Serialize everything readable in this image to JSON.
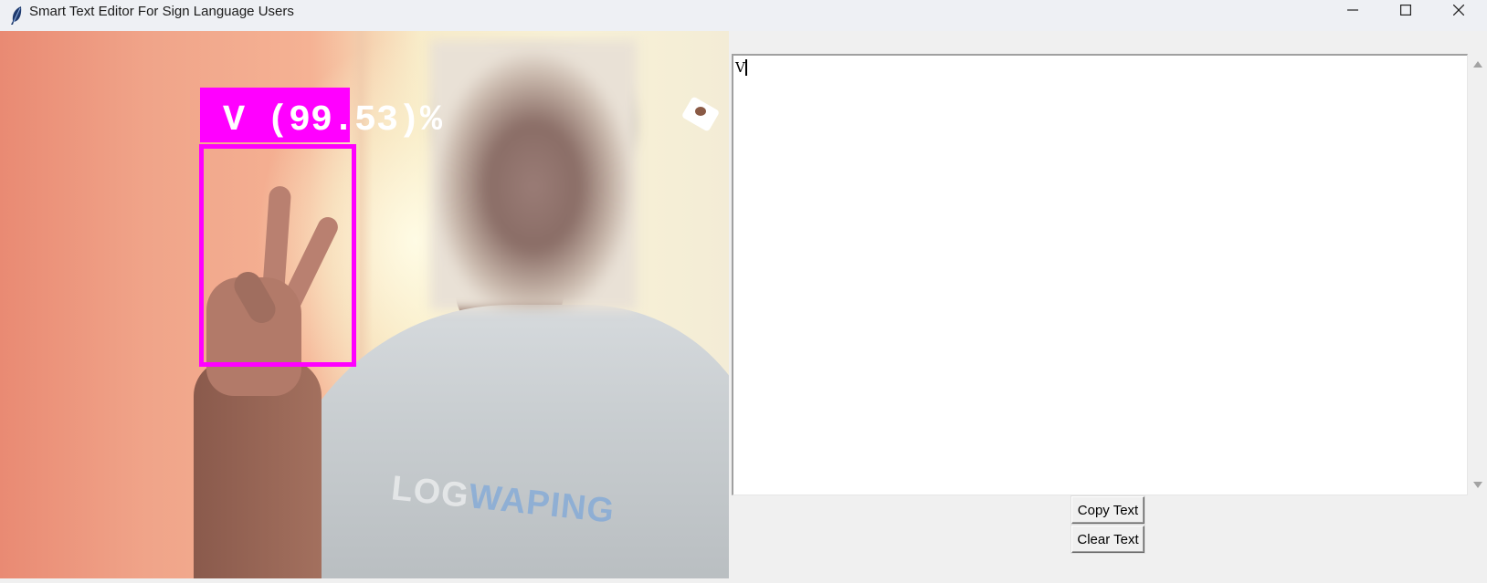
{
  "window": {
    "title": "Smart Text Editor For Sign Language Users",
    "icon": "feather-icon",
    "controls": [
      "minimize-icon",
      "maximize-icon",
      "close-icon"
    ]
  },
  "camera": {
    "detection_label": "V (99.53)%",
    "detection_color": "#ff00ff",
    "shirt_print": {
      "part1": "LOG",
      "part2": "WAPING"
    }
  },
  "editor": {
    "text": "V"
  },
  "buttons": {
    "copy_label": "Copy Text",
    "clear_label": "Clear Text"
  }
}
